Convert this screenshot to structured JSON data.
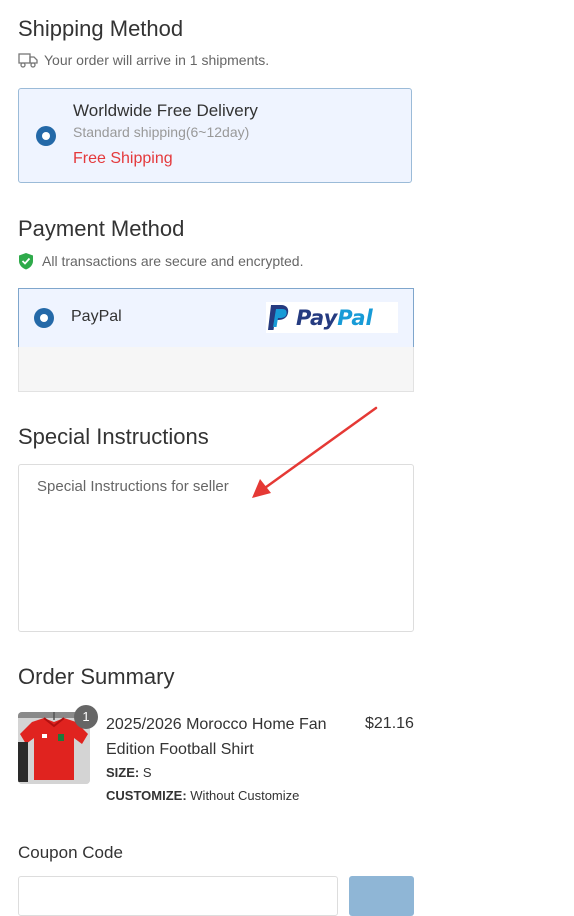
{
  "shipping": {
    "title": "Shipping Method",
    "note": "Your order will arrive in 1 shipments.",
    "note_icon": "truck-icon",
    "option": {
      "name": "Worldwide Free Delivery",
      "description": "Standard shipping(6~12day)",
      "price": "Free Shipping",
      "selected": true
    }
  },
  "payment": {
    "title": "Payment Method",
    "note": "All transactions are secure and encrypted.",
    "note_icon": "shield-check-icon",
    "option": {
      "label": "PayPal",
      "logo_text_pay": "Pay",
      "logo_text_pal": "Pal",
      "selected": true
    }
  },
  "instructions": {
    "title": "Special Instructions",
    "placeholder": "Special Instructions for seller",
    "value": ""
  },
  "summary": {
    "title": "Order Summary",
    "items": [
      {
        "quantity": "1",
        "name": "2025/2026 Morocco Home Fan Edition Football Shirt",
        "price": "$21.16",
        "size_label": "SIZE:",
        "size_value": "S",
        "customize_label": "CUSTOMIZE:",
        "customize_value": "Without Customize"
      }
    ]
  },
  "coupon": {
    "title": "Coupon Code",
    "placeholder": ""
  },
  "colors": {
    "accent": "#2469a8",
    "selected_bg": "#eff4ff",
    "free_shipping": "#e4393c",
    "annotation_arrow": "#e53935"
  }
}
